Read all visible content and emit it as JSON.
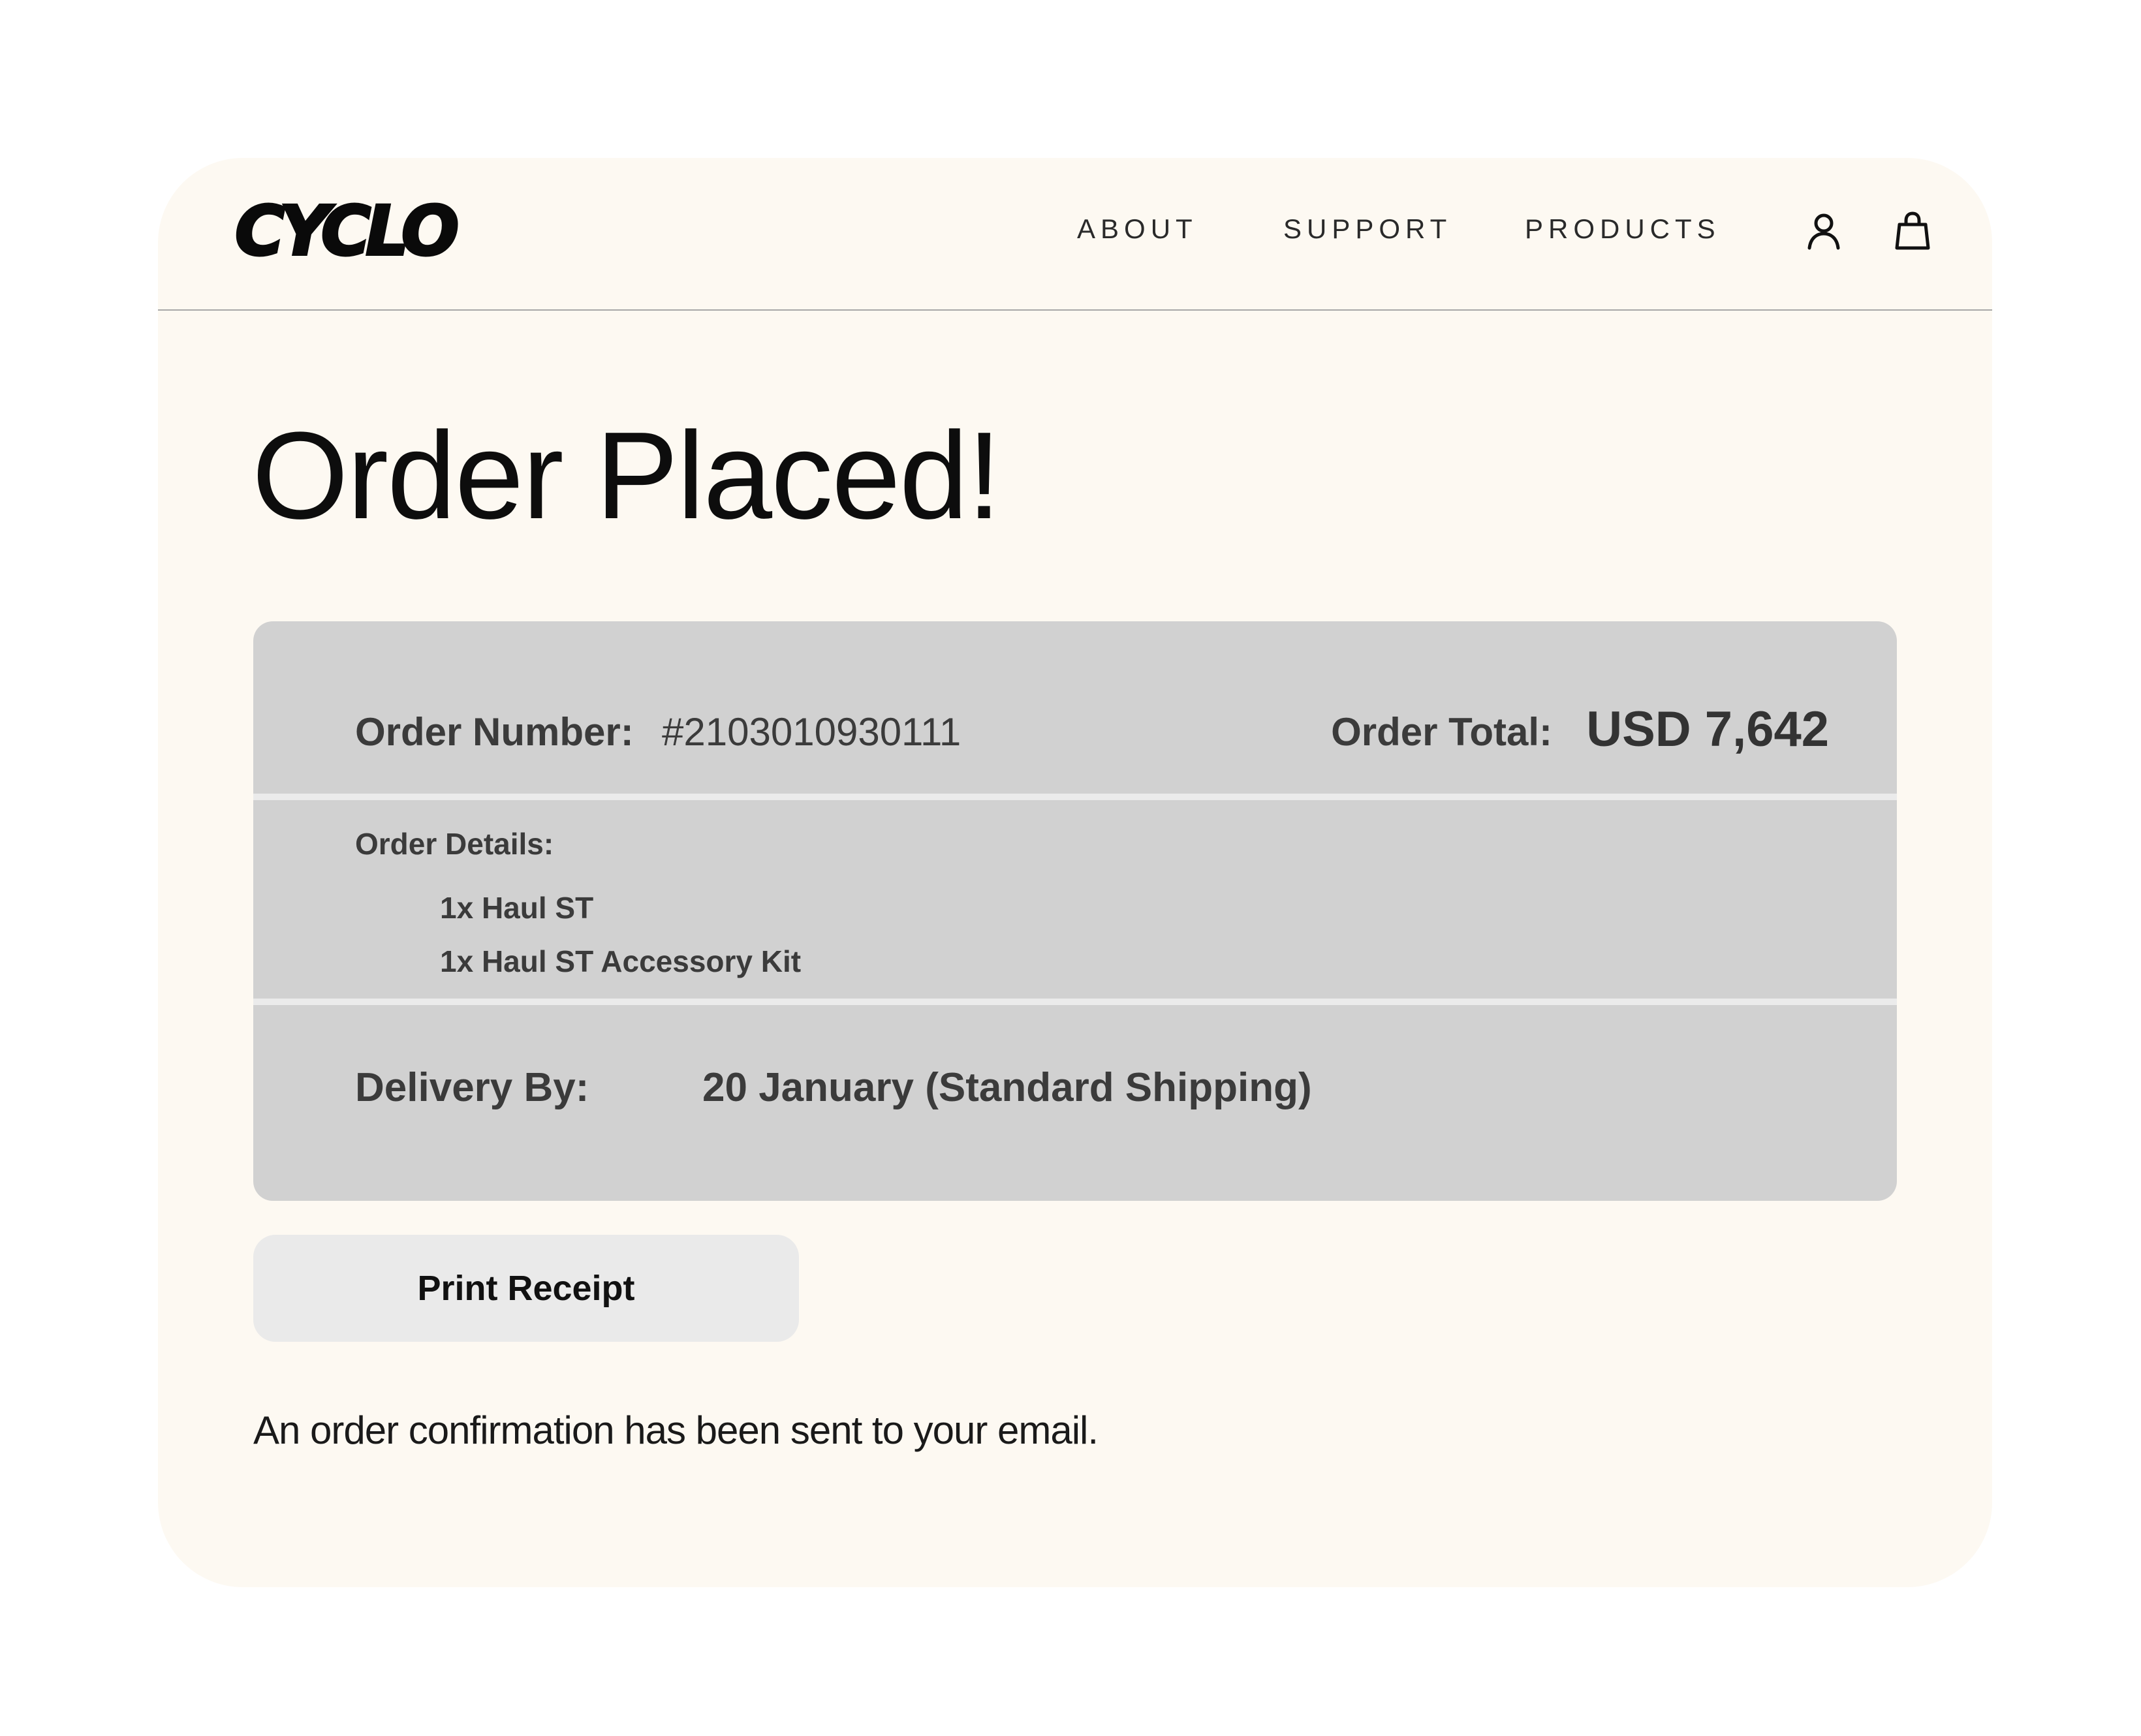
{
  "brand": {
    "logo_text": "CYCLO"
  },
  "nav": {
    "links": [
      "ABOUT",
      "SUPPORT",
      "PRODUCTS"
    ],
    "icons": [
      "account-icon",
      "shopping-bag-icon"
    ]
  },
  "page": {
    "title": "Order Placed!"
  },
  "order": {
    "number_label": "Order Number:",
    "number_value": "#2103010930111",
    "total_label": "Order Total:",
    "total_value": "USD 7,642",
    "details_label": "Order Details:",
    "items": [
      "1x Haul ST",
      "1x Haul ST Accessory Kit"
    ],
    "delivery_label": "Delivery By:",
    "delivery_value": "20 January (Standard Shipping)"
  },
  "actions": {
    "print_label": "Print Receipt"
  },
  "footer": {
    "confirmation": "An order confirmation has been sent to your email."
  },
  "colors": {
    "page_bg": "#ffffff",
    "frame_bg": "#fdf9f2",
    "card_bg": "#d1d1d1",
    "divider": "#ebebeb",
    "button_bg": "#eaeaea"
  }
}
